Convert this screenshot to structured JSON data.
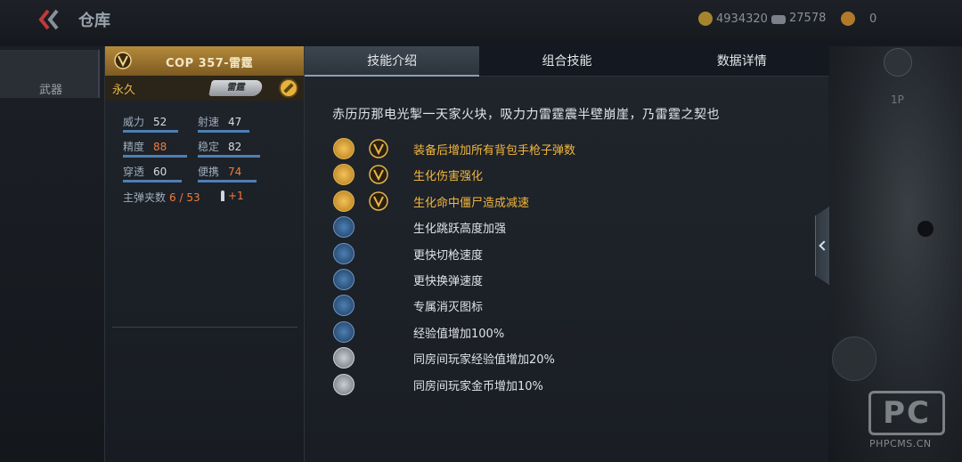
{
  "topbar": {
    "title": "仓库",
    "currency_1": "4934320",
    "currency_2": "27578",
    "currency_3": "0"
  },
  "sidebar": {
    "tab_label": "武器"
  },
  "right_edge": {
    "view_label": "1P"
  },
  "weapon": {
    "name": "COP 357-雷霆",
    "duration": "永久",
    "thumb_label": "雷霆",
    "stats": [
      {
        "label": "威力",
        "value": "52",
        "highlight": false
      },
      {
        "label": "射速",
        "value": "47",
        "highlight": false
      },
      {
        "label": "精度",
        "value": "88",
        "highlight": true
      },
      {
        "label": "稳定",
        "value": "82",
        "highlight": false
      },
      {
        "label": "穿透",
        "value": "60",
        "highlight": false
      },
      {
        "label": "便携",
        "value": "74",
        "highlight": true
      }
    ],
    "ammo_label": "主弹夹数",
    "ammo_value": "6 / 53",
    "ammo_extra": "+1"
  },
  "tabs": [
    "技能介绍",
    "组合技能",
    "数据详情"
  ],
  "description": "赤历历那电光掣一天家火块，吸力力雷霆震半壁崩崖，乃雷霆之契也",
  "skills": [
    {
      "text": "装备后增加所有背包手枪子弹数",
      "style": "gold",
      "icon": "pistol-icon",
      "vip": true
    },
    {
      "text": "生化伤害强化",
      "style": "gold",
      "icon": "claw-icon",
      "vip": true
    },
    {
      "text": "生化命中僵尸造成减速",
      "style": "gold",
      "icon": "bullets-icon",
      "vip": true
    },
    {
      "text": "生化跳跃高度加强",
      "style": "light",
      "icon": "jump-icon",
      "vip": false
    },
    {
      "text": "更快切枪速度",
      "style": "light",
      "icon": "swap-icon",
      "vip": false
    },
    {
      "text": "更快换弹速度",
      "style": "light",
      "icon": "reload-icon",
      "vip": false
    },
    {
      "text": "专属消灭图标",
      "style": "light",
      "icon": "kill-mark-icon",
      "vip": false
    },
    {
      "text": "经验值增加100%",
      "style": "light",
      "icon": "exp-icon",
      "vip": false
    },
    {
      "text": "同房间玩家经验值增加20%",
      "style": "light",
      "icon": "room-exp-icon",
      "vip": false
    },
    {
      "text": "同房间玩家金币增加10%",
      "style": "light",
      "icon": "room-gold-icon",
      "vip": false
    }
  ],
  "watermark": {
    "logo": "PC",
    "site": "PHPCMS.CN"
  },
  "colors": {
    "gold": "#f2b63d",
    "orange": "#f07c3a",
    "panel": "#1f242b"
  }
}
